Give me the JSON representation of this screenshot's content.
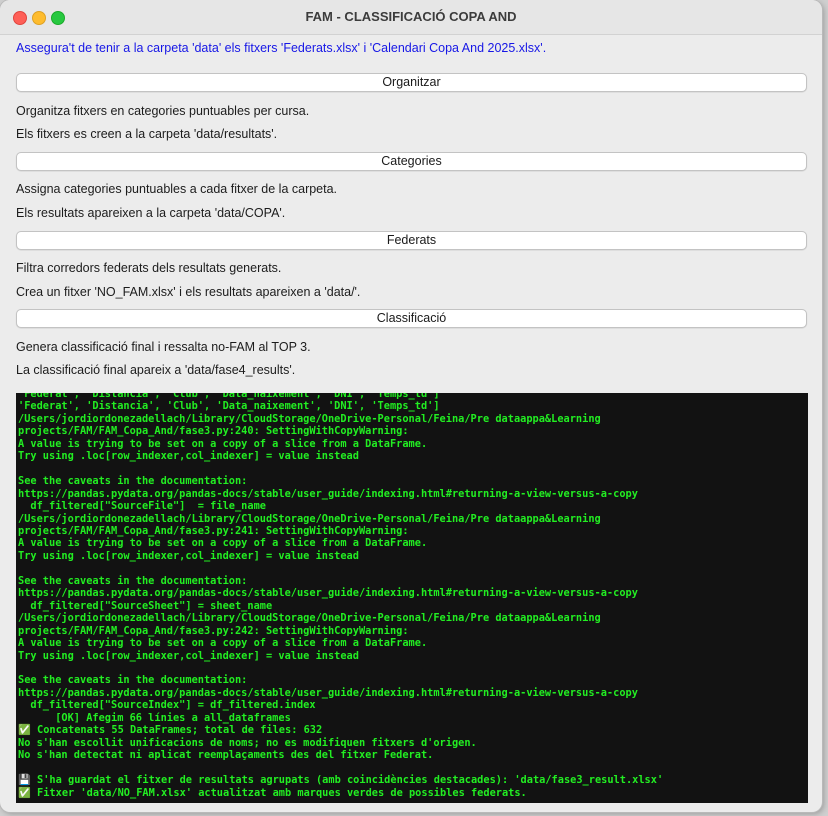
{
  "window": {
    "title": "FAM - CLASSIFICACIÓ COPA AND"
  },
  "notice": "Assegura't de tenir a la carpeta 'data' els fitxers 'Federats.xlsx' i 'Calendari Copa And 2025.xlsx'.",
  "steps": [
    {
      "button": "Organitzar",
      "line1": "Organitza fitxers en categories puntuables per cursa.",
      "line2": "Els fitxers es creen a la carpeta 'data/resultats'."
    },
    {
      "button": "Categories",
      "line1": "Assigna categories puntuables a cada fitxer de la carpeta.",
      "line2": "Els resultats apareixen a la carpeta 'data/COPA'."
    },
    {
      "button": "Federats",
      "line1": "Filtra corredors federats dels resultats generats.",
      "line2": "Crea un fitxer 'NO_FAM.xlsx' i els resultats apareixen a 'data/'."
    },
    {
      "button": "Classificació",
      "line1": "Genera classificació final i ressalta no-FAM al TOP 3.",
      "line2": "La classificació final apareix a 'data/fase4_results'."
    }
  ],
  "console": {
    "text_color": "#22ee22",
    "background": "#121212",
    "lines": [
      "'Federat', 'Distancia', 'Club', 'Data_naixement', 'DNI', 'Temps_td']",
      "'Federat', 'Distancia', 'Club', 'Data_naixement', 'DNI', 'Temps_td']",
      "/Users/jordiordonezadellach/Library/CloudStorage/OneDrive-Personal/Feina/Pre dataappa&Learning",
      "projects/FAM/FAM_Copa_And/fase3.py:240: SettingWithCopyWarning:",
      "A value is trying to be set on a copy of a slice from a DataFrame.",
      "Try using .loc[row_indexer,col_indexer] = value instead",
      "",
      "See the caveats in the documentation:",
      "https://pandas.pydata.org/pandas-docs/stable/user_guide/indexing.html#returning-a-view-versus-a-copy",
      "  df_filtered[\"SourceFile\"]  = file_name",
      "/Users/jordiordonezadellach/Library/CloudStorage/OneDrive-Personal/Feina/Pre dataappa&Learning",
      "projects/FAM/FAM_Copa_And/fase3.py:241: SettingWithCopyWarning:",
      "A value is trying to be set on a copy of a slice from a DataFrame.",
      "Try using .loc[row_indexer,col_indexer] = value instead",
      "",
      "See the caveats in the documentation:",
      "https://pandas.pydata.org/pandas-docs/stable/user_guide/indexing.html#returning-a-view-versus-a-copy",
      "  df_filtered[\"SourceSheet\"] = sheet_name",
      "/Users/jordiordonezadellach/Library/CloudStorage/OneDrive-Personal/Feina/Pre dataappa&Learning",
      "projects/FAM/FAM_Copa_And/fase3.py:242: SettingWithCopyWarning:",
      "A value is trying to be set on a copy of a slice from a DataFrame.",
      "Try using .loc[row_indexer,col_indexer] = value instead",
      "",
      "See the caveats in the documentation:",
      "https://pandas.pydata.org/pandas-docs/stable/user_guide/indexing.html#returning-a-view-versus-a-copy",
      "  df_filtered[\"SourceIndex\"] = df_filtered.index",
      "      [OK] Afegim 66 línies a all_dataframes",
      "✅ Concatenats 55 DataFrames; total de files: 632",
      "No s'han escollit unificacions de noms; no es modifiquen fitxers d'origen.",
      "No s'han detectat ni aplicat reemplaçaments des del fitxer Federat.",
      "",
      "💾 S'ha guardat el fitxer de resultats agrupats (amb coincidències destacades): 'data/fase3_result.xlsx'",
      "✅ Fitxer 'data/NO_FAM.xlsx' actualitzat amb marques verdes de possibles federats."
    ]
  }
}
